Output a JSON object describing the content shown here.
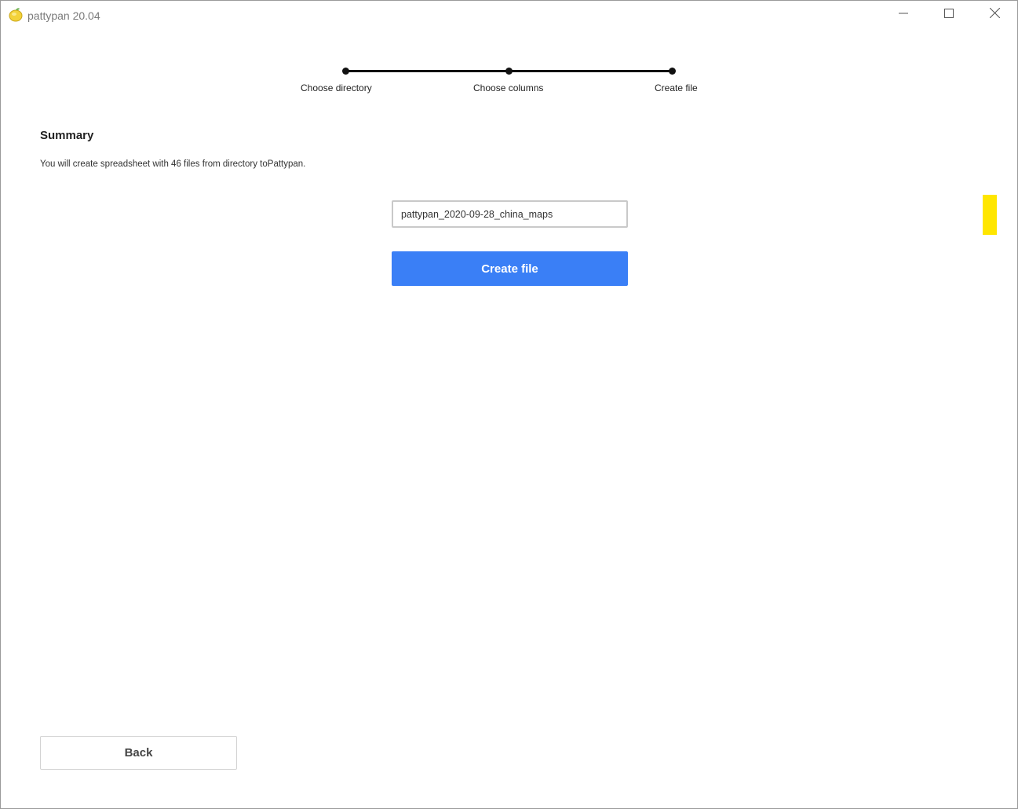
{
  "window": {
    "title": "pattypan 20.04",
    "icon": "lemon-icon",
    "controls": [
      "minimize-icon",
      "maximize-icon",
      "close-icon"
    ]
  },
  "stepper": {
    "steps": [
      {
        "label": "Choose directory"
      },
      {
        "label": "Choose columns"
      },
      {
        "label": "Create file"
      }
    ]
  },
  "summary": {
    "heading": "Summary",
    "text": "You will create spreadsheet with 46 files from directory toPattypan."
  },
  "file": {
    "name_value": "pattypan_2020-09-28_china_maps",
    "create_label": "Create file"
  },
  "navigation": {
    "back_label": "Back"
  },
  "colors": {
    "accent": "#3a7ff6",
    "marker": "#ffe600"
  }
}
